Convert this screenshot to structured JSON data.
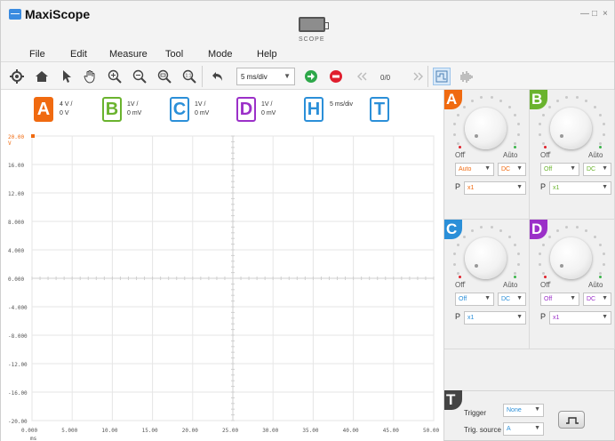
{
  "window": {
    "title": "MaxiScope",
    "scope_label": "SCOPE",
    "minimize": "—",
    "maximize": "□",
    "close": "×"
  },
  "menu": [
    "File",
    "Edit",
    "Measure",
    "Tool",
    "Mode",
    "Help"
  ],
  "toolbar": {
    "timebase": "5  ms/div",
    "counter": "0/0"
  },
  "channels": {
    "A": {
      "letter": "A",
      "scale": "4 V /",
      "offset": "0 V",
      "color": "#f06a10"
    },
    "B": {
      "letter": "B",
      "scale": "1V /",
      "offset": "0 mV",
      "color": "#6ab32e"
    },
    "C": {
      "letter": "C",
      "scale": "1V /",
      "offset": "0 mV",
      "color": "#2b8fd8"
    },
    "D": {
      "letter": "D",
      "scale": "1V /",
      "offset": "0 mV",
      "color": "#9b30c8"
    },
    "H": {
      "letter": "H",
      "scale": "5 ms/div",
      "color": "#2b8fd8"
    },
    "T": {
      "letter": "T",
      "color": "#2b8fd8"
    }
  },
  "plot": {
    "y_unit": "V",
    "x_unit": "ms",
    "y_ticks": [
      "20.00",
      "16.00",
      "12.00",
      "8.000",
      "4.000",
      "0.000",
      "-4.000",
      "-8.000",
      "-12.00",
      "-16.00",
      "-20.00"
    ],
    "x_ticks": [
      "0.000",
      "5.000",
      "10.00",
      "15.00",
      "20.00",
      "25.00",
      "30.00",
      "35.00",
      "40.00",
      "45.00",
      "50.00"
    ]
  },
  "panels": [
    {
      "tag": "A",
      "tag_color": "#f06a10",
      "off": "Off",
      "auto": "Auto",
      "sel1": "Auto",
      "sel2": "DC",
      "p": "P",
      "probe": "x1",
      "text_color": "#f06a10"
    },
    {
      "tag": "B",
      "tag_color": "#6ab32e",
      "off": "Off",
      "auto": "Auto",
      "sel1": "Off",
      "sel2": "DC",
      "p": "P",
      "probe": "x1",
      "text_color": "#6ab32e"
    },
    {
      "tag": "C",
      "tag_color": "#2b8fd8",
      "off": "Off",
      "auto": "Auto",
      "sel1": "Off",
      "sel2": "DC",
      "p": "P",
      "probe": "x1",
      "text_color": "#2b8fd8"
    },
    {
      "tag": "D",
      "tag_color": "#9b30c8",
      "off": "Off",
      "auto": "Auto",
      "sel1": "Off",
      "sel2": "DC",
      "p": "P",
      "probe": "x1",
      "text_color": "#9b30c8"
    }
  ],
  "trigger": {
    "tag": "T",
    "trigger_label": "Trigger",
    "trigger_value": "None",
    "source_label": "Trig. source",
    "source_value": "A"
  }
}
